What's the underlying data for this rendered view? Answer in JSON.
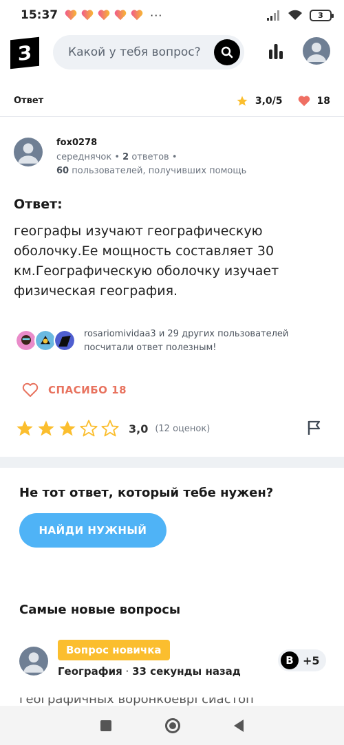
{
  "status_bar": {
    "time": "15:37",
    "more": "···",
    "battery": "3"
  },
  "header": {
    "logo": "З",
    "search_placeholder": "Какой у тебя вопрос?"
  },
  "answer_bar": {
    "label": "Ответ",
    "rating": "3,0/5",
    "likes": "18"
  },
  "author": {
    "name": "fox0278",
    "rank": "середнячок",
    "answers_count": "2",
    "answers_label": "ответов",
    "helped_count": "60",
    "helped_label": "пользователей, получивших помощь"
  },
  "answer": {
    "heading": "Ответ:",
    "text": "географы изучают географическую оболочку.Ее мощность составляет 30 км.Географическую оболочку изучает физическая география."
  },
  "helpers": {
    "text": "rosariomividaa3 и 29 других пользователей посчитали ответ полезным!"
  },
  "thanks": {
    "label": "СПАСИБО 18"
  },
  "stars": {
    "value_num": 3,
    "value": "3,0",
    "count": "(12 оценок)"
  },
  "not_found": {
    "heading": "Не тот ответ, который тебе нужен?",
    "button": "НАЙДИ НУЖНЫЙ"
  },
  "newest": {
    "heading": "Самые новые вопросы",
    "question": {
      "badge": "Вопрос новичка",
      "subject": "География",
      "time": "33 секунды назад",
      "points": "+5",
      "points_icon": "В",
      "preview": "географичных воронкоеврі сиастоп"
    }
  },
  "colors": {
    "accent_blue": "#4fb3f6",
    "heart": "#ef6f63",
    "star": "#fbbe2e",
    "badge": "#fbbe2e"
  }
}
